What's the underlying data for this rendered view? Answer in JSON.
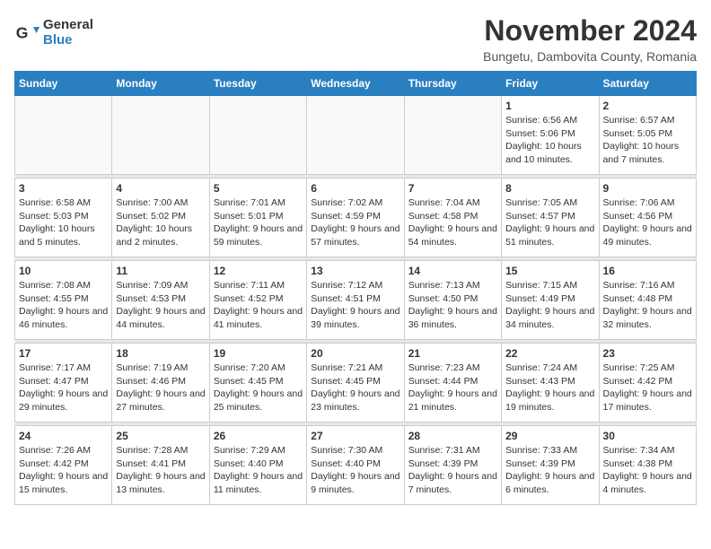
{
  "logo": {
    "general": "General",
    "blue": "Blue"
  },
  "title": "November 2024",
  "subtitle": "Bungetu, Dambovita County, Romania",
  "days_of_week": [
    "Sunday",
    "Monday",
    "Tuesday",
    "Wednesday",
    "Thursday",
    "Friday",
    "Saturday"
  ],
  "weeks": [
    [
      {
        "day": "",
        "info": ""
      },
      {
        "day": "",
        "info": ""
      },
      {
        "day": "",
        "info": ""
      },
      {
        "day": "",
        "info": ""
      },
      {
        "day": "",
        "info": ""
      },
      {
        "day": "1",
        "info": "Sunrise: 6:56 AM\nSunset: 5:06 PM\nDaylight: 10 hours and 10 minutes."
      },
      {
        "day": "2",
        "info": "Sunrise: 6:57 AM\nSunset: 5:05 PM\nDaylight: 10 hours and 7 minutes."
      }
    ],
    [
      {
        "day": "3",
        "info": "Sunrise: 6:58 AM\nSunset: 5:03 PM\nDaylight: 10 hours and 5 minutes."
      },
      {
        "day": "4",
        "info": "Sunrise: 7:00 AM\nSunset: 5:02 PM\nDaylight: 10 hours and 2 minutes."
      },
      {
        "day": "5",
        "info": "Sunrise: 7:01 AM\nSunset: 5:01 PM\nDaylight: 9 hours and 59 minutes."
      },
      {
        "day": "6",
        "info": "Sunrise: 7:02 AM\nSunset: 4:59 PM\nDaylight: 9 hours and 57 minutes."
      },
      {
        "day": "7",
        "info": "Sunrise: 7:04 AM\nSunset: 4:58 PM\nDaylight: 9 hours and 54 minutes."
      },
      {
        "day": "8",
        "info": "Sunrise: 7:05 AM\nSunset: 4:57 PM\nDaylight: 9 hours and 51 minutes."
      },
      {
        "day": "9",
        "info": "Sunrise: 7:06 AM\nSunset: 4:56 PM\nDaylight: 9 hours and 49 minutes."
      }
    ],
    [
      {
        "day": "10",
        "info": "Sunrise: 7:08 AM\nSunset: 4:55 PM\nDaylight: 9 hours and 46 minutes."
      },
      {
        "day": "11",
        "info": "Sunrise: 7:09 AM\nSunset: 4:53 PM\nDaylight: 9 hours and 44 minutes."
      },
      {
        "day": "12",
        "info": "Sunrise: 7:11 AM\nSunset: 4:52 PM\nDaylight: 9 hours and 41 minutes."
      },
      {
        "day": "13",
        "info": "Sunrise: 7:12 AM\nSunset: 4:51 PM\nDaylight: 9 hours and 39 minutes."
      },
      {
        "day": "14",
        "info": "Sunrise: 7:13 AM\nSunset: 4:50 PM\nDaylight: 9 hours and 36 minutes."
      },
      {
        "day": "15",
        "info": "Sunrise: 7:15 AM\nSunset: 4:49 PM\nDaylight: 9 hours and 34 minutes."
      },
      {
        "day": "16",
        "info": "Sunrise: 7:16 AM\nSunset: 4:48 PM\nDaylight: 9 hours and 32 minutes."
      }
    ],
    [
      {
        "day": "17",
        "info": "Sunrise: 7:17 AM\nSunset: 4:47 PM\nDaylight: 9 hours and 29 minutes."
      },
      {
        "day": "18",
        "info": "Sunrise: 7:19 AM\nSunset: 4:46 PM\nDaylight: 9 hours and 27 minutes."
      },
      {
        "day": "19",
        "info": "Sunrise: 7:20 AM\nSunset: 4:45 PM\nDaylight: 9 hours and 25 minutes."
      },
      {
        "day": "20",
        "info": "Sunrise: 7:21 AM\nSunset: 4:45 PM\nDaylight: 9 hours and 23 minutes."
      },
      {
        "day": "21",
        "info": "Sunrise: 7:23 AM\nSunset: 4:44 PM\nDaylight: 9 hours and 21 minutes."
      },
      {
        "day": "22",
        "info": "Sunrise: 7:24 AM\nSunset: 4:43 PM\nDaylight: 9 hours and 19 minutes."
      },
      {
        "day": "23",
        "info": "Sunrise: 7:25 AM\nSunset: 4:42 PM\nDaylight: 9 hours and 17 minutes."
      }
    ],
    [
      {
        "day": "24",
        "info": "Sunrise: 7:26 AM\nSunset: 4:42 PM\nDaylight: 9 hours and 15 minutes."
      },
      {
        "day": "25",
        "info": "Sunrise: 7:28 AM\nSunset: 4:41 PM\nDaylight: 9 hours and 13 minutes."
      },
      {
        "day": "26",
        "info": "Sunrise: 7:29 AM\nSunset: 4:40 PM\nDaylight: 9 hours and 11 minutes."
      },
      {
        "day": "27",
        "info": "Sunrise: 7:30 AM\nSunset: 4:40 PM\nDaylight: 9 hours and 9 minutes."
      },
      {
        "day": "28",
        "info": "Sunrise: 7:31 AM\nSunset: 4:39 PM\nDaylight: 9 hours and 7 minutes."
      },
      {
        "day": "29",
        "info": "Sunrise: 7:33 AM\nSunset: 4:39 PM\nDaylight: 9 hours and 6 minutes."
      },
      {
        "day": "30",
        "info": "Sunrise: 7:34 AM\nSunset: 4:38 PM\nDaylight: 9 hours and 4 minutes."
      }
    ]
  ]
}
